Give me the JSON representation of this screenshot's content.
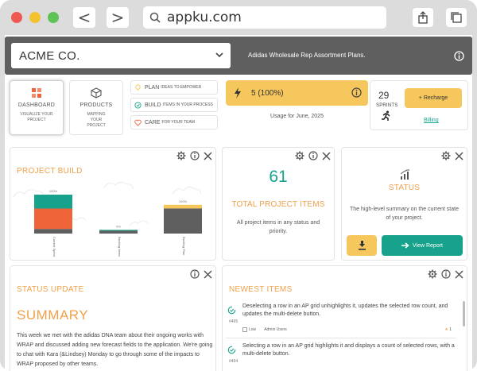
{
  "browser": {
    "url": "appku.com",
    "back_glyph": "<",
    "forward_glyph": ">"
  },
  "header": {
    "company": "ACME CO.",
    "plan_text": "Adidas Wholesale Rep Assortment Plans."
  },
  "nav_tiles": [
    {
      "title": "DASHBOARD",
      "subtitle": "VISUALIZE YOUR PROJECT",
      "icon": "dashboard-icon",
      "active": true
    },
    {
      "title": "PRODUCTS",
      "subtitle": "MAPPING YOUR PROJECT",
      "icon": "box-icon",
      "active": false
    }
  ],
  "features": [
    {
      "main": "PLAN",
      "sub": "IDEAS TO EMPOWER",
      "icon": "bulb-icon"
    },
    {
      "main": "BUILD",
      "sub": "ITEMS IN YOUR PROCESS",
      "icon": "cycle-icon"
    },
    {
      "main": "CARE",
      "sub": "FOR YOUR TEAM",
      "icon": "heart-icon"
    }
  ],
  "credits": {
    "value": "5 (100%)",
    "usage": "Usage for June, 2025"
  },
  "sprints": {
    "count": "29",
    "label": "SPRINTS",
    "recharge_label": "+ Recharge",
    "billing_label": "Billing"
  },
  "project_build": {
    "title": "PROJECT BUILD",
    "chart_data": {
      "type": "bar",
      "stacked": true,
      "categories": [
        "Current Sprint",
        "Backlog Items",
        "Backlog Plan"
      ],
      "percent_labels": [
        "100%",
        "0%",
        "100%"
      ],
      "series": [
        {
          "color": "#5f5f5f",
          "values": [
            5,
            3,
            27
          ]
        },
        {
          "color": "#f0643a",
          "values": [
            22,
            0,
            0
          ]
        },
        {
          "color": "#17a28c",
          "values": [
            15,
            1,
            0
          ]
        },
        {
          "color": "#f6c75c",
          "values": [
            0,
            0,
            4
          ]
        }
      ],
      "ylim": [
        0,
        60
      ]
    }
  },
  "total_items": {
    "value": "61",
    "title": "TOTAL PROJECT ITEMS",
    "desc": "All project items in any status and priority."
  },
  "status": {
    "title": "STATUS",
    "desc": "The high-level summary on the current state of your project.",
    "report_label": "View Report"
  },
  "status_update": {
    "title": "STATUS UPDATE",
    "summary": "SUMMARY",
    "text": "This week we met with the adidas DNA team about their ongoing works with WRAP and discussed adding new forecast fields to the application. We're going to chat with Kara (&Lindsey) Monday to go through some of the impacts to WRAP proposed by other teams."
  },
  "newest_items": {
    "title": "NEWEST ITEMS",
    "items": [
      {
        "text": "Deselecting a row in an AP grid unhighlights it, updates the selected row count, and updates the multi-delete button.",
        "id": "#495",
        "priority": "Low",
        "owner": "Admin Users",
        "count": "1"
      },
      {
        "text": "Selecting a row in an AP grid highlights it and displays a count of selected rows, with a multi-delete button.",
        "id": "#494"
      }
    ]
  },
  "colors": {
    "accent": "#f1a04a",
    "teal": "#17a28c",
    "yellow": "#f6c75c",
    "header": "#5f5f5f"
  }
}
